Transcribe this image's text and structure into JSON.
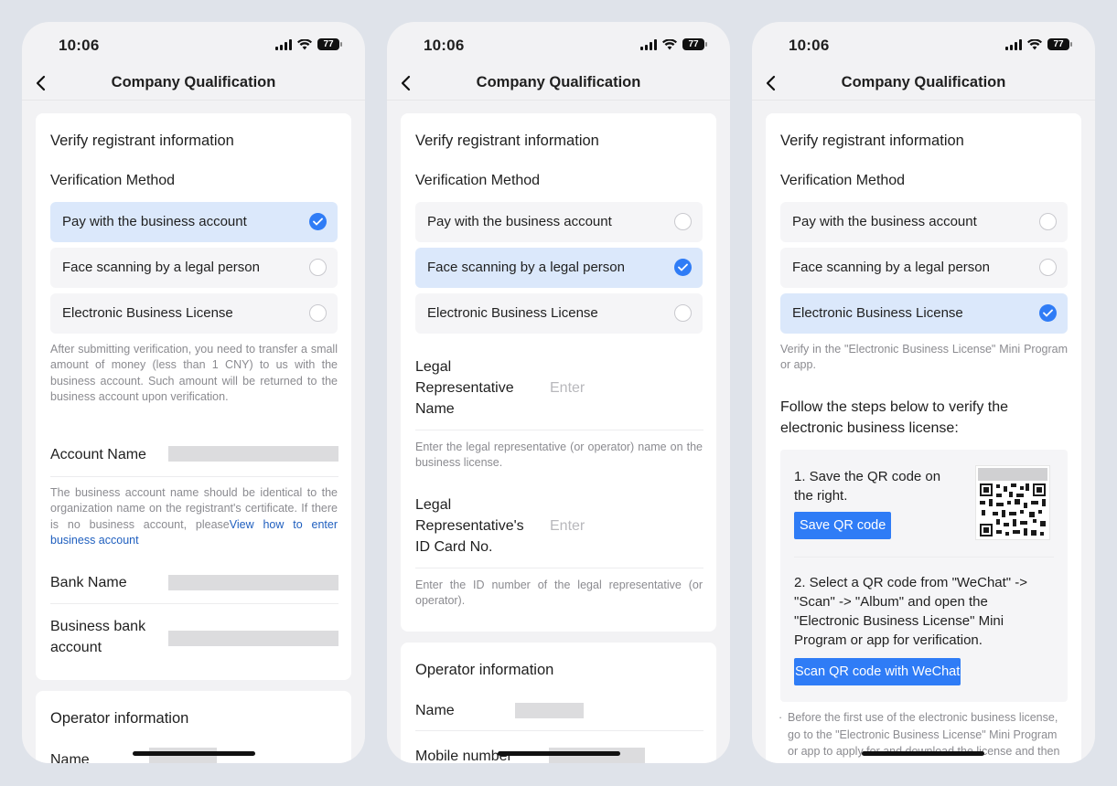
{
  "status_time": "10:06",
  "battery": "77",
  "nav_title": "Company Qualification",
  "verify_title": "Verify registrant information",
  "method_label": "Verification Method",
  "options": [
    "Pay with the business account",
    "Face scanning by a legal person",
    "Electronic Business License"
  ],
  "accent_color": "#2f7cf6",
  "screen1": {
    "selected": "Pay with the business account",
    "transfer_hint": "After submitting verification, you need to transfer a small amount of money (less than 1 CNY) to us with the business account. Such amount will be returned to the business account upon verification.",
    "account_name_label": "Account Name",
    "account_hint": "The business account name should be identical to the organization name on the registrant's certificate. If there is no business account, please",
    "account_hint_link": "View how to enter business account",
    "bank_name_label": "Bank Name",
    "bank_account_label": "Business bank account",
    "operator_title": "Operator information",
    "name_label": "Name"
  },
  "screen2": {
    "selected": "Face scanning by a legal person",
    "legal_name_label": "Legal Representative Name",
    "legal_name_placeholder": "Enter",
    "legal_name_hint": "Enter the legal representative (or operator) name on the business license.",
    "id_label": "Legal Representative's ID Card No.",
    "id_placeholder": "Enter",
    "id_hint": "Enter the ID number of the legal representative (or operator).",
    "operator_title": "Operator information",
    "name_label": "Name",
    "mobile_label": "Mobile number"
  },
  "screen3": {
    "selected": "Electronic Business License",
    "verify_hint": "Verify in the \"Electronic Business License\" Mini Program or app.",
    "follow_text": "Follow the steps below to verify the electronic business license:",
    "step1_text": "1. Save the QR code on the right.",
    "save_qr_button": "Save QR code",
    "step2_text": "2. Select a QR code from \"WeChat\" -> \"Scan\" -> \"Album\" and open the \"Electronic Business License\" Mini Program or app for verification.",
    "scan_button": "Scan QR code with WeChat",
    "bullet_text": "Before the first use of the electronic business license, go to the \"Electronic Business License\" Mini Program or app to apply for and download the license and then scan the QR code for"
  }
}
